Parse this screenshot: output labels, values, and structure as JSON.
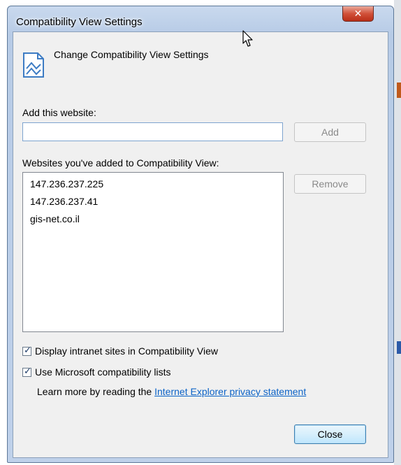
{
  "window": {
    "title": "Compatibility View Settings",
    "close_glyph": "✕"
  },
  "header": {
    "title": "Change Compatibility View Settings",
    "icon": "compatibility-view-icon"
  },
  "add_website": {
    "label": "Add this website:",
    "value": "",
    "placeholder": "",
    "add_button": "Add"
  },
  "websites": {
    "label": "Websites you've added to Compatibility View:",
    "items": [
      "147.236.237.225",
      "147.236.237.41",
      "gis-net.co.il"
    ],
    "remove_button": "Remove"
  },
  "options": {
    "intranet_label": "Display intranet sites in Compatibility View",
    "intranet_checked": true,
    "ms_lists_label": "Use Microsoft compatibility lists",
    "ms_lists_checked": true
  },
  "learn_more": {
    "prefix": "Learn more by reading the ",
    "link_text": "Internet Explorer privacy statement"
  },
  "footer": {
    "close_button": "Close"
  },
  "colors": {
    "link": "#0b63c7",
    "close_button_red": "#c8402a"
  }
}
